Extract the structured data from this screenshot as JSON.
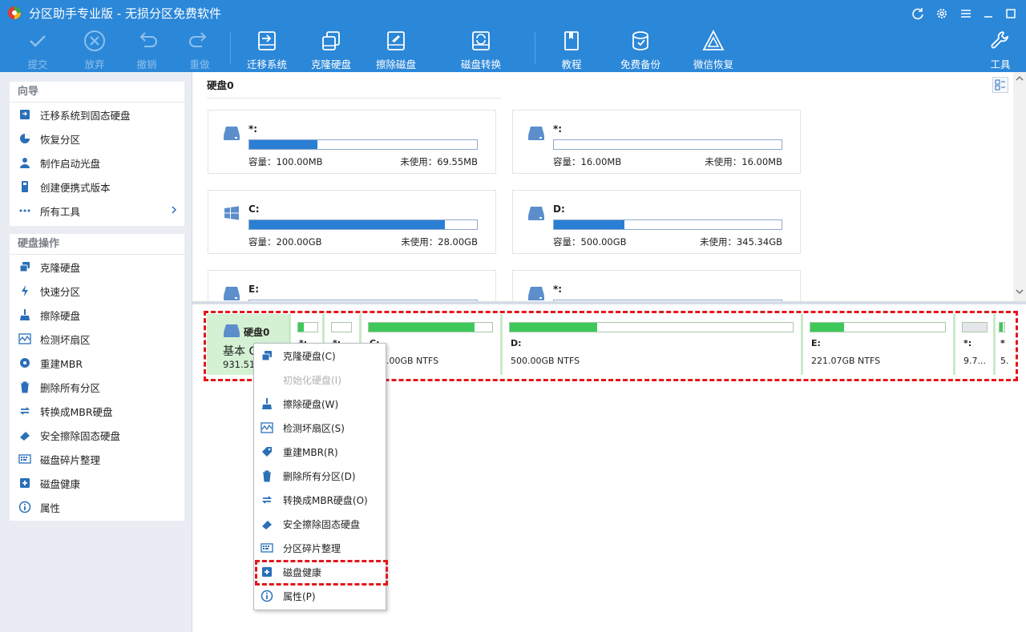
{
  "title": "分区助手专业版 - 无损分区免费软件",
  "toolbar": {
    "commit": "提交",
    "discard": "放弃",
    "undo": "撤销",
    "redo": "重做",
    "migrate": "迁移系统",
    "clone": "克隆硬盘",
    "wipe": "擦除磁盘",
    "convert": "磁盘转换",
    "tutorial": "教程",
    "backup": "免费备份",
    "wechat": "微信恢复",
    "tools": "工具"
  },
  "sidebar": {
    "wizard_title": "向导",
    "wizard_items": [
      "迁移系统到固态硬盘",
      "恢复分区",
      "制作启动光盘",
      "创建便携式版本",
      "所有工具"
    ],
    "disk_ops_title": "硬盘操作",
    "disk_ops_items": [
      "克隆硬盘",
      "快速分区",
      "擦除硬盘",
      "检测坏扇区",
      "重建MBR",
      "删除所有分区",
      "转换成MBR硬盘",
      "安全擦除固态硬盘",
      "磁盘碎片整理",
      "磁盘健康",
      "属性"
    ]
  },
  "main": {
    "disk_header": "硬盘0",
    "cards": [
      {
        "name": "*:",
        "cap": "容量：100.00MB",
        "free": "未使用：69.55MB",
        "used_fraction": 0.3,
        "icon": "drive-icon"
      },
      {
        "name": "*:",
        "cap": "容量：16.00MB",
        "free": "未使用：16.00MB",
        "used_fraction": 0.0,
        "icon": "drive-icon"
      },
      {
        "name": "C:",
        "cap": "容量：200.00GB",
        "free": "未使用：28.00GB",
        "used_fraction": 0.86,
        "icon": "windows-icon"
      },
      {
        "name": "D:",
        "cap": "容量：500.00GB",
        "free": "未使用：345.34GB",
        "used_fraction": 0.31,
        "icon": "drive-icon"
      },
      {
        "name": "E:",
        "icon": "drive-icon"
      },
      {
        "name": "*:",
        "icon": "drive-icon"
      }
    ]
  },
  "diskmap": {
    "disk_name": "硬盘0",
    "disk_type": "基本 G",
    "disk_size": "931.51",
    "segments": [
      {
        "label": "*:",
        "info": "",
        "used_fraction": 0.3
      },
      {
        "label": "*:",
        "info": "",
        "used_fraction": 0.0
      },
      {
        "label": "C:",
        "info": "200.00GB NTFS",
        "used_fraction": 0.86
      },
      {
        "label": "D:",
        "info": "500.00GB NTFS",
        "used_fraction": 0.31
      },
      {
        "label": "E:",
        "info": "221.07GB NTFS",
        "used_fraction": 0.25
      },
      {
        "label": "*:",
        "info": "9.7...",
        "used_fraction": 0.0
      },
      {
        "label": "*",
        "info": "5.",
        "used_fraction": 0.6
      }
    ]
  },
  "context_menu": {
    "items": [
      {
        "label": "克隆硬盘(C)",
        "disabled": false,
        "icon": "clone-disk-icon"
      },
      {
        "label": "初始化硬盘(I)",
        "disabled": true,
        "icon": ""
      },
      {
        "label": "擦除硬盘(W)",
        "disabled": false,
        "icon": "broom-icon"
      },
      {
        "label": "检测坏扇区(S)",
        "disabled": false,
        "icon": "pulse-icon"
      },
      {
        "label": "重建MBR(R)",
        "disabled": false,
        "icon": "tag-icon"
      },
      {
        "label": "删除所有分区(D)",
        "disabled": false,
        "icon": "trash-icon"
      },
      {
        "label": "转换成MBR硬盘(O)",
        "disabled": false,
        "icon": "convert-icon"
      },
      {
        "label": "安全擦除固态硬盘",
        "disabled": false,
        "icon": "eraser-icon"
      },
      {
        "label": "分区碎片整理",
        "disabled": false,
        "icon": "defrag-icon"
      },
      {
        "label": "磁盘健康",
        "disabled": false,
        "icon": "disk-health-icon"
      },
      {
        "label": "属性(P)",
        "disabled": false,
        "icon": "info-icon"
      }
    ]
  },
  "colors": {
    "titlebar": "#2b87d8",
    "accent": "#2a7fd4",
    "used_green": "#3ec85a",
    "highlight_red": "#e3161b"
  }
}
